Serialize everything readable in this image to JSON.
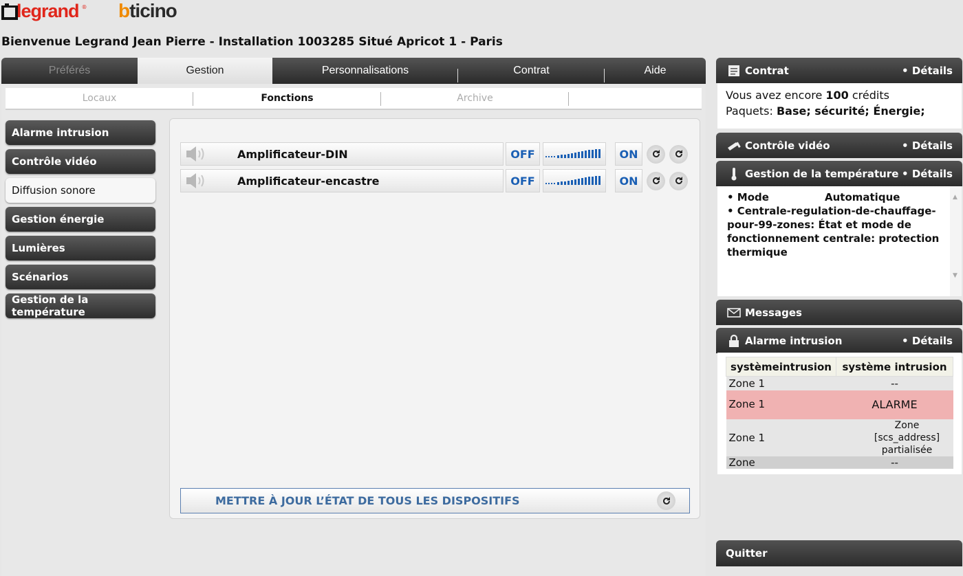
{
  "brand": {
    "legrand": "legrand",
    "reg_mark": "®",
    "bticino_b": "b",
    "bticino_rest": "ticino"
  },
  "welcome": "Bienvenue Legrand Jean Pierre - Installation 1003285 Situé Apricot 1 - Paris",
  "main_tabs": [
    {
      "label": "Préférés"
    },
    {
      "label": "Gestion"
    },
    {
      "label": "Personnalisations"
    },
    {
      "label": "Contrat"
    },
    {
      "label": "Aide"
    }
  ],
  "sub_tabs": [
    {
      "label": "Locaux"
    },
    {
      "label": "Fonctions"
    },
    {
      "label": "Archive"
    }
  ],
  "sidebar": {
    "items": [
      {
        "label": "Alarme intrusion"
      },
      {
        "label": "Contrôle vidéo"
      },
      {
        "label": "Diffusion sonore"
      },
      {
        "label": "Gestion énergie"
      },
      {
        "label": "Lumières"
      },
      {
        "label": "Scénarios"
      },
      {
        "label": "Gestion de la température"
      }
    ]
  },
  "devices": [
    {
      "name": "Amplificateur-DIN",
      "off_label": "OFF",
      "on_label": "ON"
    },
    {
      "name": "Amplificateur-encastre",
      "off_label": "OFF",
      "on_label": "ON"
    }
  ],
  "update_all_label": "METTRE À JOUR L’ÉTAT DE TOUS LES DISPOSITIFS",
  "contract": {
    "title": "Contrat",
    "details": "• Détails",
    "credits_prefix": "Vous avez encore ",
    "credits_value": "100",
    "credits_suffix": " crédits",
    "packages_prefix": "Paquets: ",
    "packages_value": "Base; sécurité; Énergie;"
  },
  "video": {
    "title": "Contrôle vidéo",
    "details": "• Détails"
  },
  "temperature": {
    "title": "Gestion de la température",
    "details": "• Détails",
    "mode_label": "• Mode",
    "mode_value": "Automatique",
    "status_text": "• Centrale-regulation-de-chauffage-pour-99-zones: État et mode de fonctionnement centrale: protection thermique"
  },
  "messages": {
    "title": "Messages"
  },
  "alarm": {
    "title": "Alarme intrusion",
    "details": "• Détails",
    "headers": [
      "systèmeintrusion",
      "système intrusion"
    ],
    "rows": [
      {
        "zone": "Zone 1",
        "status": "--"
      },
      {
        "zone": "Zone 1",
        "status": "ALARME"
      },
      {
        "zone": "Zone 1",
        "status": "Zone [scs_address] partialisée"
      },
      {
        "zone": "Zone",
        "status": "--"
      }
    ]
  },
  "quit_label": "Quitter",
  "colors": {
    "accent_blue": "#1a5fb4",
    "alarm_red": "#f0b2b2",
    "logo_red": "#e0261b",
    "logo_orange": "#f08a00"
  }
}
